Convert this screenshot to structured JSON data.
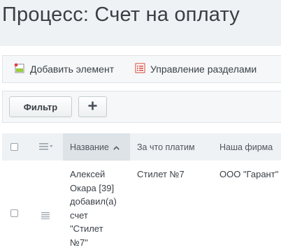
{
  "page": {
    "title": "Процесс: Счет на оплату"
  },
  "toolbar": {
    "add_label": "Добавить элемент",
    "sections_label": "Управление разделами"
  },
  "filter_bar": {
    "filter_label": "Фильтр",
    "plus_label": "+"
  },
  "grid": {
    "columns": [
      {
        "label": "Название",
        "sorted": "asc"
      },
      {
        "label": "За что платим"
      },
      {
        "label": "Наша фирма"
      }
    ],
    "rows": [
      {
        "name_lines": [
          "Алексей",
          "Окара [39]",
          "добавил(а)",
          "счет",
          "\"Стилет",
          "№7\""
        ],
        "pay_for": "Стилет №7",
        "our_firm": "ООО \"Гарант\""
      }
    ]
  },
  "icons": {
    "add": "add-element-icon",
    "sections": "sections-list-icon",
    "columns_menu": "menu-lines-icon",
    "row_menu": "hamburger-icon",
    "sort": "chevron-up-icon"
  }
}
